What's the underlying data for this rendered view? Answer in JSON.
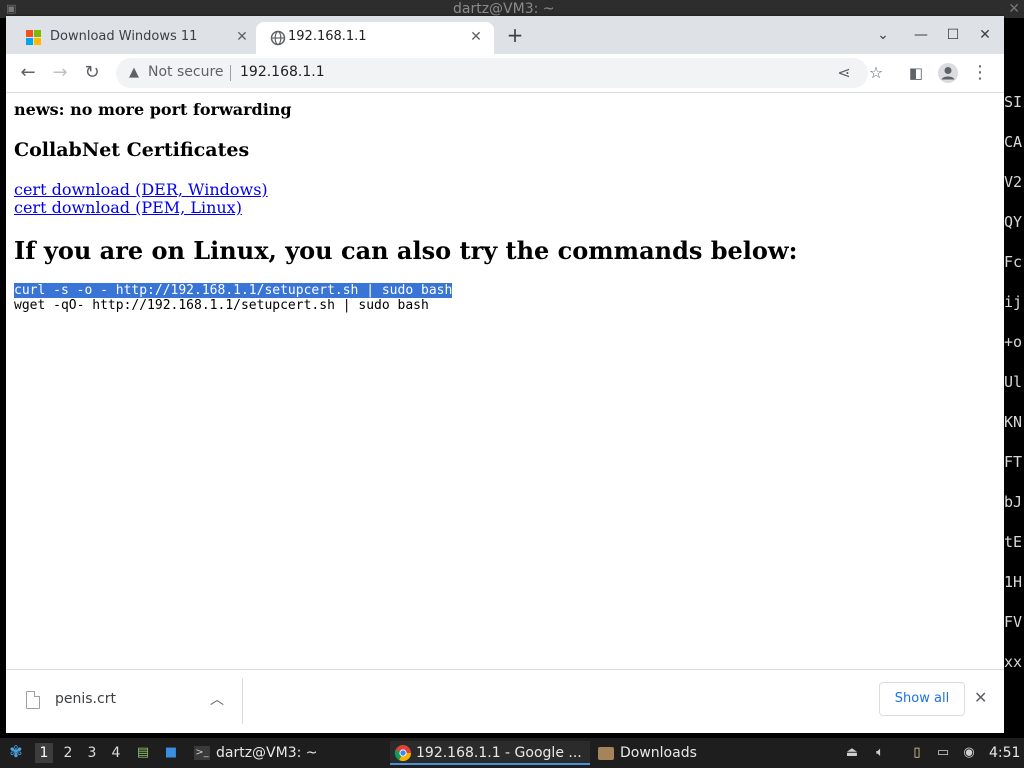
{
  "terminal": {
    "title": "dartz@VM3: ~",
    "right_fragments": [
      "SI",
      "CA",
      "V2",
      "QY",
      "Fc",
      "ij",
      "+o",
      "Ul",
      "KN",
      "FT",
      "bJ",
      "tE",
      "1H",
      "FV",
      "xx"
    ]
  },
  "browser": {
    "tabs": [
      {
        "label": "Download Windows 11",
        "active": false,
        "icon": "windows-logo-icon"
      },
      {
        "label": "192.168.1.1",
        "active": true,
        "icon": "globe-icon"
      }
    ],
    "address": {
      "security_label": "Not secure",
      "url": "192.168.1.1"
    },
    "page": {
      "news": "news: no more port forwarding",
      "certs_heading": "CollabNet Certificates",
      "links": [
        "cert download (DER, Windows)",
        "cert download (PEM, Linux)"
      ],
      "linux_heading": "If you are on Linux, you can also try the commands below:",
      "commands": [
        "curl -s -o - http://192.168.1.1/setupcert.sh | sudo bash",
        "wget -qO- http://192.168.1.1/setupcert.sh | sudo bash"
      ]
    },
    "download_bar": {
      "file_name": "penis.crt",
      "show_all_label": "Show all"
    }
  },
  "taskbar": {
    "workspaces": [
      "1",
      "2",
      "3",
      "4"
    ],
    "items": [
      {
        "label": "dartz@VM3: ~",
        "icon": "terminal-icon"
      },
      {
        "label": "192.168.1.1 - Google ...",
        "icon": "chrome-icon",
        "active": true
      },
      {
        "label": "Downloads",
        "icon": "folder-icon"
      }
    ],
    "clock": "4:51"
  },
  "colors": {
    "selection": "#3875d7",
    "link": "#0000ee",
    "show_all": "#1a73e8"
  }
}
